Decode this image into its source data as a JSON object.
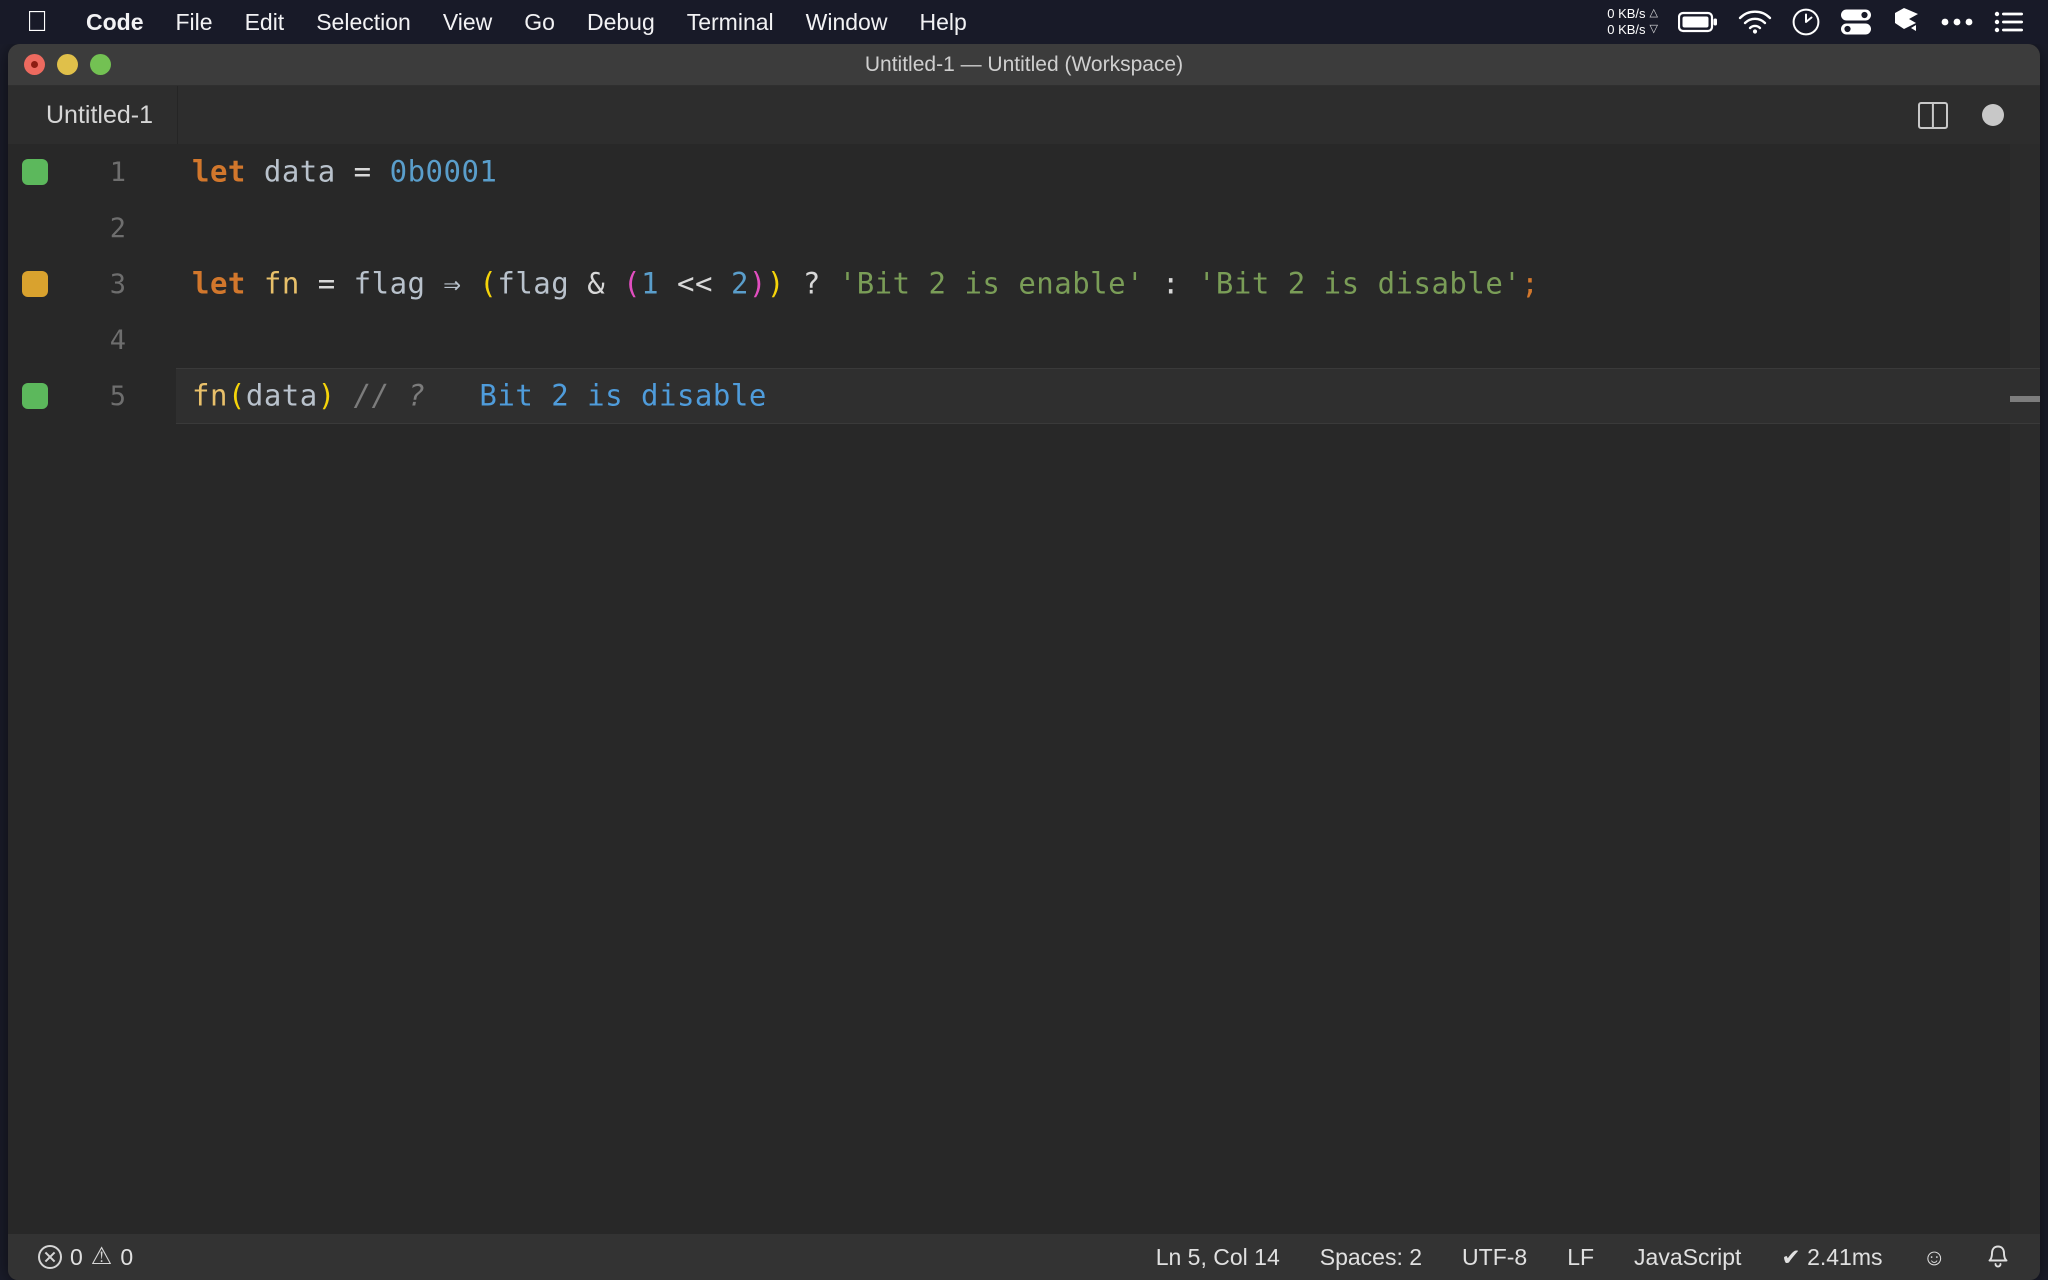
{
  "menubar": {
    "apple_icon": "apple-logo",
    "items": [
      {
        "label": "Code",
        "bold": true
      },
      {
        "label": "File"
      },
      {
        "label": "Edit"
      },
      {
        "label": "Selection"
      },
      {
        "label": "View"
      },
      {
        "label": "Go"
      },
      {
        "label": "Debug"
      },
      {
        "label": "Terminal"
      },
      {
        "label": "Window"
      },
      {
        "label": "Help"
      }
    ],
    "status": {
      "net_up": "0 KB/s",
      "net_down": "0 KB/s",
      "up_arrow": "△",
      "down_arrow": "▽",
      "icons": [
        "battery-icon",
        "wifi-icon",
        "clock-icon",
        "toggles-icon",
        "dropbox-icon",
        "ellipsis-icon",
        "control-center-icon"
      ]
    }
  },
  "window": {
    "title": "Untitled-1 — Untitled (Workspace)",
    "traffic_lights": [
      "close-button",
      "minimize-button",
      "zoom-button"
    ]
  },
  "tabs": {
    "active": "Untitled-1",
    "actions": [
      "split-editor-icon",
      "unsaved-indicator"
    ]
  },
  "editor": {
    "language": "JavaScript",
    "lines": [
      {
        "number": "1",
        "marker": "green",
        "active": false,
        "tokens": [
          {
            "t": "let",
            "c": "kw"
          },
          {
            "t": " ",
            "c": "op"
          },
          {
            "t": "data",
            "c": "ident"
          },
          {
            "t": " ",
            "c": "op"
          },
          {
            "t": "=",
            "c": "op"
          },
          {
            "t": " ",
            "c": "op"
          },
          {
            "t": "0b0001",
            "c": "num"
          }
        ],
        "text": "let data = 0b0001"
      },
      {
        "number": "2",
        "marker": "none",
        "active": false,
        "tokens": [],
        "text": ""
      },
      {
        "number": "3",
        "marker": "amber",
        "active": false,
        "tokens": [
          {
            "t": "let",
            "c": "kw"
          },
          {
            "t": " ",
            "c": "op"
          },
          {
            "t": "fn",
            "c": "fname"
          },
          {
            "t": " = ",
            "c": "op"
          },
          {
            "t": "flag",
            "c": "ident"
          },
          {
            "t": " ",
            "c": "op"
          },
          {
            "t": "⇒",
            "c": "fn-arrow"
          },
          {
            "t": " ",
            "c": "op"
          },
          {
            "t": "(",
            "c": "pyellow"
          },
          {
            "t": "flag",
            "c": "ident"
          },
          {
            "t": " ",
            "c": "op"
          },
          {
            "t": "&",
            "c": "op"
          },
          {
            "t": " ",
            "c": "op"
          },
          {
            "t": "(",
            "c": "pmagenta"
          },
          {
            "t": "1",
            "c": "num"
          },
          {
            "t": " ",
            "c": "op"
          },
          {
            "t": "<<",
            "c": "op"
          },
          {
            "t": " ",
            "c": "op"
          },
          {
            "t": "2",
            "c": "num"
          },
          {
            "t": ")",
            "c": "pmagenta"
          },
          {
            "t": ")",
            "c": "pyellow"
          },
          {
            "t": " ",
            "c": "op"
          },
          {
            "t": "?",
            "c": "op"
          },
          {
            "t": " ",
            "c": "op"
          },
          {
            "t": "'Bit 2 is enable'",
            "c": "str"
          },
          {
            "t": " ",
            "c": "op"
          },
          {
            "t": ":",
            "c": "op"
          },
          {
            "t": " ",
            "c": "op"
          },
          {
            "t": "'Bit 2 is disable'",
            "c": "str"
          },
          {
            "t": ";",
            "c": "semi"
          }
        ],
        "text": "let fn = flag ⇒ (flag & (1 << 2)) ? 'Bit 2 is enable' : 'Bit 2 is disable';"
      },
      {
        "number": "4",
        "marker": "none",
        "active": false,
        "tokens": [],
        "text": ""
      },
      {
        "number": "5",
        "marker": "green",
        "active": true,
        "tokens": [
          {
            "t": "fn",
            "c": "fname"
          },
          {
            "t": "(",
            "c": "pyellow"
          },
          {
            "t": "data",
            "c": "ident"
          },
          {
            "t": ")",
            "c": "pyellow"
          },
          {
            "t": " ",
            "c": "op"
          },
          {
            "t": "//",
            "c": "comment"
          },
          {
            "t": " ",
            "c": "op"
          },
          {
            "t": "?",
            "c": "comment"
          },
          {
            "t": "   ",
            "c": "op"
          },
          {
            "t": "Bit 2 is disable",
            "c": "inline-res"
          }
        ],
        "text": "fn(data) // ?   Bit 2 is disable"
      }
    ]
  },
  "statusbar": {
    "errors_icon": "error-circle-icon",
    "errors": "0",
    "warnings_icon": "warning-triangle-icon",
    "warnings": "0",
    "cursor": "Ln 5, Col 14",
    "indentation": "Spaces: 2",
    "encoding": "UTF-8",
    "eol": "LF",
    "language": "JavaScript",
    "runtime": "✔ 2.41ms",
    "feedback_icon": "☺",
    "bell_icon": "bell-icon"
  },
  "colors": {
    "menubar_bg": "#181a28",
    "titlebar_bg": "#3c3c3c",
    "tabrow_bg": "#2d2d2d",
    "editor_bg": "#282828",
    "statusbar_bg": "#333333",
    "keyword": "#d2772c",
    "number": "#5a9ecb",
    "string": "#7a9d57",
    "function": "#e8c06a",
    "bracket_yellow": "#f5d40a",
    "bracket_magenta": "#e24ec0",
    "comment": "#7c7c7c",
    "inline_result": "#4f9cdb",
    "marker_green": "#5cb85c",
    "marker_amber": "#d9a22e"
  }
}
